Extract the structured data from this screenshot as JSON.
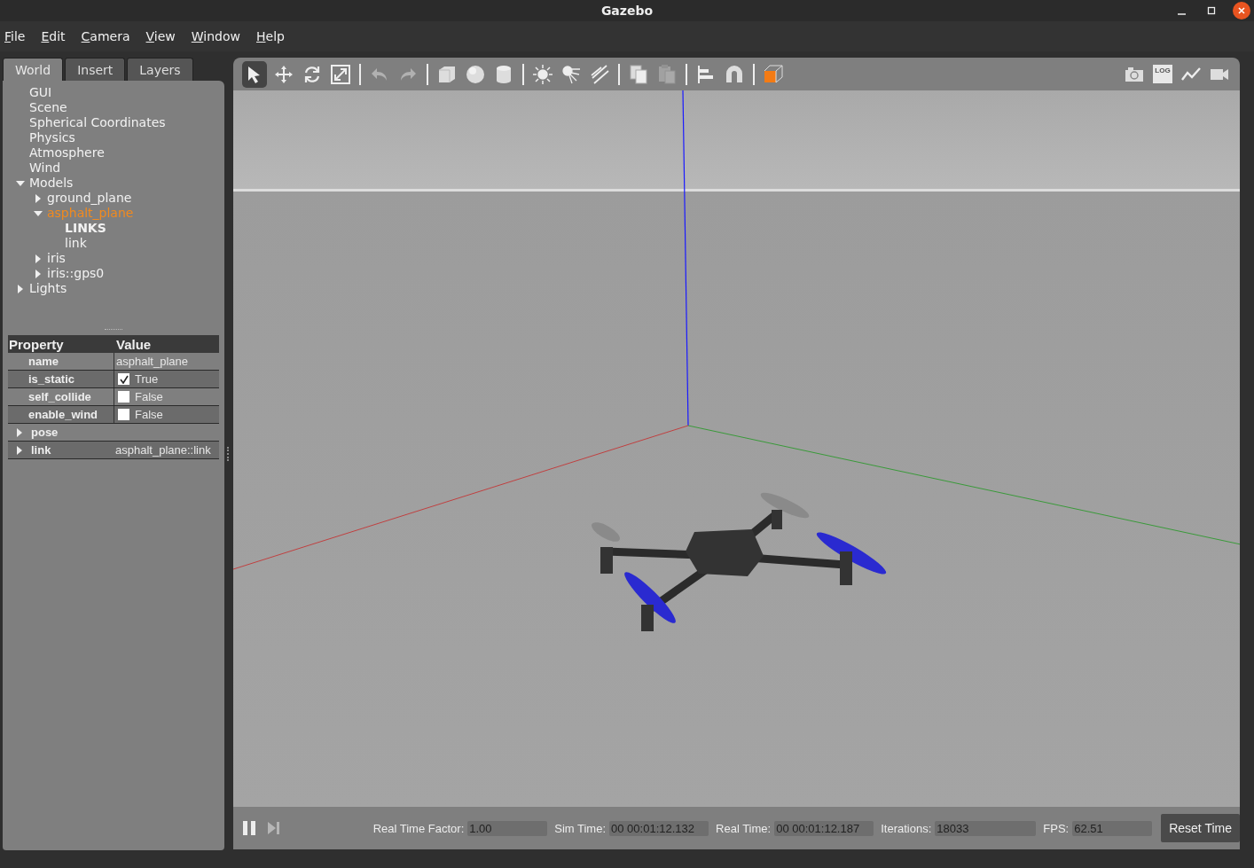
{
  "window": {
    "title": "Gazebo"
  },
  "menu": [
    {
      "label": "File"
    },
    {
      "label": "Edit"
    },
    {
      "label": "Camera"
    },
    {
      "label": "View"
    },
    {
      "label": "Window"
    },
    {
      "label": "Help"
    }
  ],
  "tabs": [
    {
      "label": "World",
      "selected": true
    },
    {
      "label": "Insert",
      "selected": false
    },
    {
      "label": "Layers",
      "selected": false
    }
  ],
  "tree": [
    {
      "label": "GUI",
      "selected": false
    },
    {
      "label": "Scene",
      "selected": false
    },
    {
      "label": "Spherical Coordinates",
      "selected": false
    },
    {
      "label": "Physics",
      "selected": false
    },
    {
      "label": "Atmosphere",
      "selected": false
    },
    {
      "label": "Wind",
      "selected": false
    },
    {
      "label": "Models",
      "selected": false,
      "expanded": true,
      "children": [
        {
          "label": "ground_plane",
          "selected": false,
          "expanded": false
        },
        {
          "label": "asphalt_plane",
          "selected": true,
          "expanded": true,
          "children": [
            {
              "label": "LINKS",
              "selected": false,
              "kind": "heading"
            },
            {
              "label": "link",
              "selected": false
            }
          ]
        },
        {
          "label": "iris",
          "selected": false,
          "expanded": false
        },
        {
          "label": "iris::gps0",
          "selected": false,
          "expanded": false
        }
      ]
    },
    {
      "label": "Lights",
      "selected": false,
      "expanded": false
    }
  ],
  "properties": {
    "columns": [
      "Property",
      "Value"
    ],
    "rows": [
      {
        "kind": "field",
        "name": "name",
        "value": "asphalt_plane"
      },
      {
        "kind": "checkbox",
        "name": "is_static",
        "checked": true,
        "value": "True"
      },
      {
        "kind": "checkbox",
        "name": "self_collide",
        "checked": false,
        "value": "False"
      },
      {
        "kind": "checkbox",
        "name": "enable_wind",
        "checked": false,
        "value": "False"
      },
      {
        "kind": "group",
        "name": "pose",
        "expanded": false
      },
      {
        "kind": "group",
        "name": "link",
        "expanded": false,
        "value": "asphalt_plane::link"
      }
    ]
  },
  "toolbar": {
    "groups": [
      [
        {
          "kind": "select",
          "selected": true,
          "disabled": false
        },
        {
          "kind": "translate",
          "selected": false,
          "disabled": false
        },
        {
          "kind": "rotate",
          "selected": false,
          "disabled": false
        },
        {
          "kind": "scale",
          "selected": false,
          "disabled": false
        }
      ],
      [
        {
          "kind": "undo",
          "selected": false,
          "disabled": true
        },
        {
          "kind": "redo",
          "selected": false,
          "disabled": true
        }
      ],
      [
        {
          "kind": "box",
          "selected": false,
          "disabled": false
        },
        {
          "kind": "sphere",
          "selected": false,
          "disabled": false
        },
        {
          "kind": "cylinder",
          "selected": false,
          "disabled": false
        }
      ],
      [
        {
          "kind": "pointlight",
          "selected": false,
          "disabled": false
        },
        {
          "kind": "spotlight",
          "selected": false,
          "disabled": false
        },
        {
          "kind": "dirlight",
          "selected": false,
          "disabled": false
        }
      ],
      [
        {
          "kind": "copy",
          "selected": false,
          "disabled": false
        },
        {
          "kind": "paste",
          "selected": false,
          "disabled": true
        }
      ],
      [
        {
          "kind": "align",
          "selected": false,
          "disabled": false
        },
        {
          "kind": "magnet",
          "selected": false,
          "disabled": false
        }
      ],
      [
        {
          "kind": "view",
          "selected": false,
          "disabled": false
        }
      ]
    ],
    "right": [
      {
        "kind": "camera"
      },
      {
        "kind": "log",
        "label": "LOG"
      },
      {
        "kind": "plot"
      },
      {
        "kind": "video"
      }
    ]
  },
  "status": {
    "paused": false,
    "fields": [
      {
        "label": "Real Time Factor:",
        "value": "1.00"
      },
      {
        "label": "Sim Time:",
        "value": "00 00:01:12.132"
      },
      {
        "label": "Real Time:",
        "value": "00 00:01:12.187"
      },
      {
        "label": "Iterations:",
        "value": "18033"
      },
      {
        "label": "FPS:",
        "value": "62.51"
      }
    ],
    "reset": "Reset Time"
  }
}
